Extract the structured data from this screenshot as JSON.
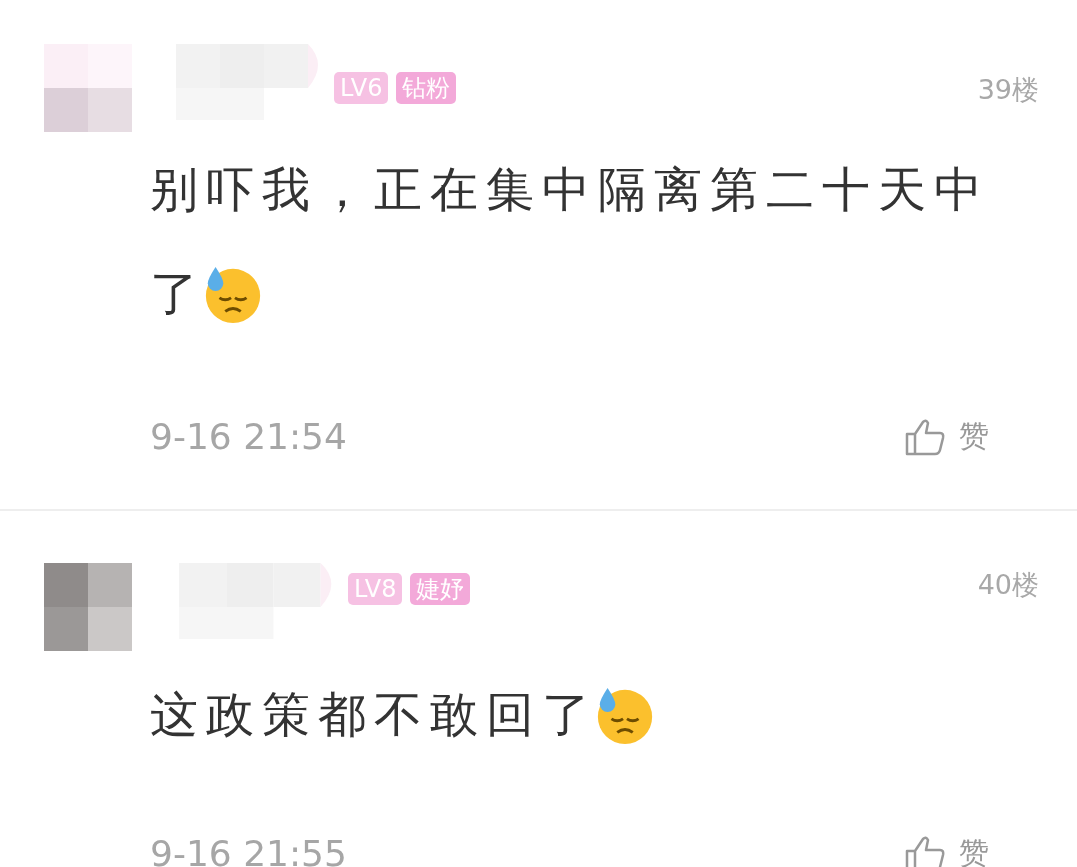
{
  "comments": [
    {
      "badges": [
        {
          "label": "LV6",
          "kind": "level"
        },
        {
          "label": "钻粉",
          "kind": "fan"
        }
      ],
      "floor": "39楼",
      "lines": [
        "别吓我，正在集中隔离第二十天中",
        "了"
      ],
      "emoji": true,
      "time": "9-16 21:54",
      "like": "赞"
    },
    {
      "badges": [
        {
          "label": "LV8",
          "kind": "level"
        },
        {
          "label": "婕妤",
          "kind": "fan"
        }
      ],
      "floor": "40楼",
      "lines": [
        "这政策都不敢回了"
      ],
      "emoji": true,
      "time": "9-16 21:55",
      "like": "赞"
    }
  ]
}
